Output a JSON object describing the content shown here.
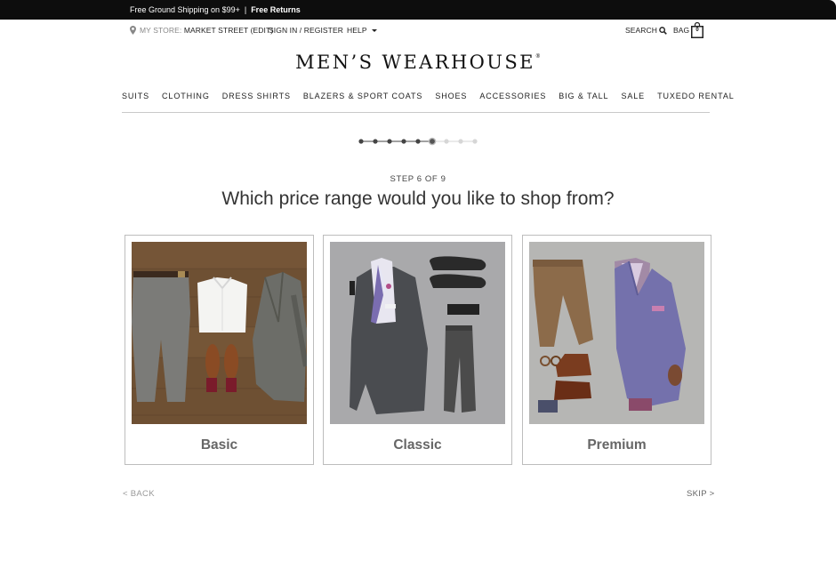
{
  "promo": {
    "shipping": "Free Ground Shipping on $99+",
    "separator": "|",
    "returns": "Free Returns"
  },
  "utility": {
    "store_prefix": "MY STORE:",
    "store_name": "MARKET STREET (EDIT)",
    "signin": "SIGN IN / REGISTER",
    "help": "HELP",
    "search": "SEARCH",
    "bag": "BAG",
    "bag_count": "0"
  },
  "brand": {
    "logo": "MEN’S WEARHOUSE",
    "registered": "®"
  },
  "nav": [
    "SUITS",
    "CLOTHING",
    "DRESS SHIRTS",
    "BLAZERS & SPORT COATS",
    "SHOES",
    "ACCESSORIES",
    "BIG & TALL",
    "SALE",
    "TUXEDO RENTAL"
  ],
  "progress": {
    "current_step": 6,
    "total_steps": 9
  },
  "quiz": {
    "step_label": "STEP 6 OF 9",
    "question": "Which price range would you like to shop from?",
    "options": [
      {
        "label": "Basic"
      },
      {
        "label": "Classic"
      },
      {
        "label": "Premium"
      }
    ]
  },
  "footer_nav": {
    "back": "< BACK",
    "skip": "SKIP >"
  },
  "colors": {
    "promo_bg": "#0d0d0d",
    "dot_done": "#444444",
    "dot_current": "#555555",
    "dot_todo": "#d6d6d6",
    "card_border": "#bdbdbd",
    "label_gray": "#666666"
  },
  "icons": [
    "map-pin-icon",
    "caret-down-icon",
    "search-icon",
    "shopping-bag-icon"
  ]
}
